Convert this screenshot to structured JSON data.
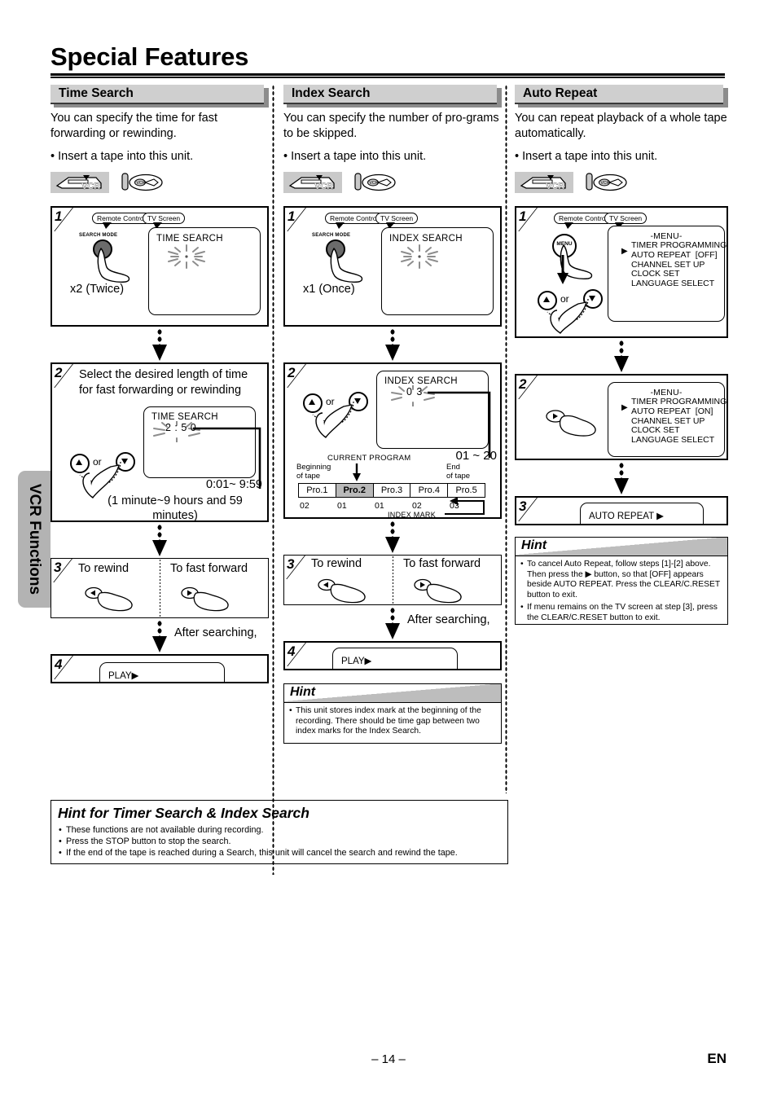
{
  "page": {
    "title": "Special Features",
    "side_tab": "VCR Functions",
    "page_number": "– 14 –",
    "language_code": "EN"
  },
  "columns": [
    {
      "id": "time-search",
      "heading": "Time Search",
      "intro": "You can specify the time for fast forwarding or rewinding.",
      "bullet": "• Insert a tape into this unit.",
      "icons": [
        "vcr-unit-icon",
        "tape-insert-icon"
      ],
      "steps": [
        {
          "num": "1",
          "callout_remote": "Remote Control",
          "callout_tv": "TV Screen",
          "button_label": "SEARCH MODE",
          "press_count": "x2 (Twice)",
          "tv_title": "TIME SEARCH",
          "tv_value": ""
        },
        {
          "num": "2",
          "instruction": "Select the desired length of time for fast forwarding or rewinding",
          "or_label": "or",
          "tv_title": "TIME SEARCH",
          "tv_value": "2 : 5 0",
          "range": "0:01~ 9:59",
          "range_note": "(1 minute~9 hours and 59 minutes)"
        },
        {
          "num": "3",
          "left_label": "To rewind",
          "right_label": "To fast forward"
        },
        {
          "num": "4",
          "play_label": "PLAY▶"
        }
      ],
      "after_searching": "After searching,"
    },
    {
      "id": "index-search",
      "heading": "Index Search",
      "intro": "You can specify the number of pro-grams to be skipped.",
      "bullet": "• Insert a tape into this unit.",
      "icons": [
        "vcr-unit-icon",
        "tape-insert-icon"
      ],
      "steps": [
        {
          "num": "1",
          "callout_remote": "Remote Control",
          "callout_tv": "TV Screen",
          "button_label": "SEARCH MODE",
          "press_count": "x1 (Once)",
          "tv_title": "INDEX SEARCH",
          "tv_value": ""
        },
        {
          "num": "2",
          "or_label": "or",
          "tv_title": "INDEX SEARCH",
          "tv_value": "0 3",
          "range": "01 ~ 20",
          "current_program_label": "CURRENT PROGRAM",
          "beginning_label": "Beginning\nof tape",
          "end_label": "End\nof tape",
          "index_mark_label": "INDEX MARK",
          "programs": [
            "Pro.1",
            "Pro.2",
            "Pro.3",
            "Pro.4",
            "Pro.5"
          ],
          "current_program_index": 1,
          "marks": [
            "02",
            "01",
            "01",
            "02",
            "03"
          ]
        },
        {
          "num": "3",
          "left_label": "To rewind",
          "right_label": "To fast forward"
        },
        {
          "num": "4",
          "play_label": "PLAY▶"
        }
      ],
      "after_searching": "After searching,",
      "hint": {
        "title": "Hint",
        "items": [
          "This unit stores index mark at the beginning of the recording. There should be time gap between two index marks for the Index Search."
        ]
      }
    },
    {
      "id": "auto-repeat",
      "heading": "Auto Repeat",
      "intro": "You can repeat playback of a whole tape automatically.",
      "bullet": "• Insert a tape into this unit.",
      "icons": [
        "vcr-unit-icon",
        "tape-insert-icon"
      ],
      "steps": [
        {
          "num": "1",
          "callout_remote": "Remote Control",
          "callout_tv": "TV Screen",
          "button_label": "MENU",
          "or_label": "or",
          "menu_title": "-MENU-",
          "menu_items": [
            "TIMER PROGRAMMING",
            "AUTO REPEAT  [OFF]",
            "CHANNEL SET UP",
            "CLOCK SET",
            "LANGUAGE SELECT"
          ],
          "cursor_row": 1
        },
        {
          "num": "2",
          "menu_title": "-MENU-",
          "menu_items": [
            "TIMER PROGRAMMING",
            "AUTO REPEAT  [ON]",
            "CHANNEL SET UP",
            "CLOCK SET",
            "LANGUAGE SELECT"
          ],
          "cursor_row": 1
        },
        {
          "num": "3",
          "play_label": "AUTO REPEAT ▶"
        }
      ],
      "hint": {
        "title": "Hint",
        "items": [
          "To cancel Auto Repeat, follow steps [1]-[2] above. Then press the ▶ button, so that [OFF] appears beside AUTO REPEAT.  Press the CLEAR/C.RESET button to exit.",
          "If menu remains on the TV screen at step [3], press the CLEAR/C.RESET button to exit."
        ]
      }
    }
  ],
  "bottom_hint": {
    "title": "Hint for Timer Search & Index Search",
    "items": [
      "These functions are not available during recording.",
      "Press the STOP button to stop the search.",
      "If the end of the tape is reached during a Search, this unit will cancel the search and rewind the tape."
    ]
  }
}
